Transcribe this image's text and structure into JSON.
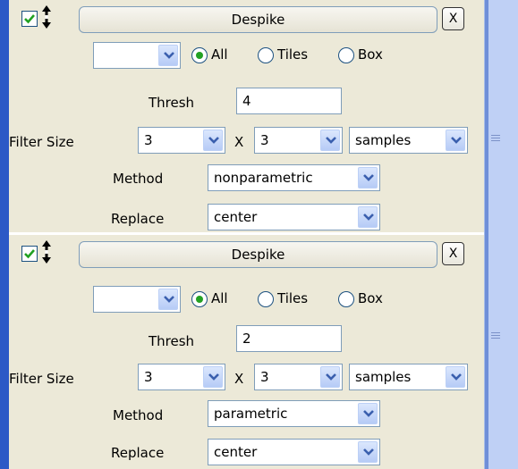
{
  "panels": [
    {
      "title": "Despike",
      "close_label": "X",
      "enabled": true,
      "region_select_value": "",
      "scope_options": [
        "All",
        "Tiles",
        "Box"
      ],
      "scope_selected": "All",
      "thresh_label": "Thresh",
      "thresh_value": "4",
      "filter_size_label": "Filter Size",
      "filter_x": "3",
      "x_separator": "X",
      "filter_y": "3",
      "filter_units": "samples",
      "method_label": "Method",
      "method_value": "nonparametric",
      "replace_label": "Replace",
      "replace_value": "center"
    },
    {
      "title": "Despike",
      "close_label": "X",
      "enabled": true,
      "region_select_value": "",
      "scope_options": [
        "All",
        "Tiles",
        "Box"
      ],
      "scope_selected": "All",
      "thresh_label": "Thresh",
      "thresh_value": "2",
      "filter_size_label": "Filter Size",
      "filter_x": "3",
      "x_separator": "X",
      "filter_y": "3",
      "filter_units": "samples",
      "method_label": "Method",
      "method_value": "parametric",
      "replace_label": "Replace",
      "replace_value": "center"
    }
  ],
  "colors": {
    "background": "#ece9d8",
    "border": "#7f9db9",
    "radio_selected": "#23a123",
    "left_strip": "#2c59c6",
    "scrollbar": "#bfd0f5"
  },
  "icons": {
    "checkbox": "checkmark-icon",
    "reorder": "up-down-arrows-icon",
    "dropdown": "chevron-down-icon"
  }
}
